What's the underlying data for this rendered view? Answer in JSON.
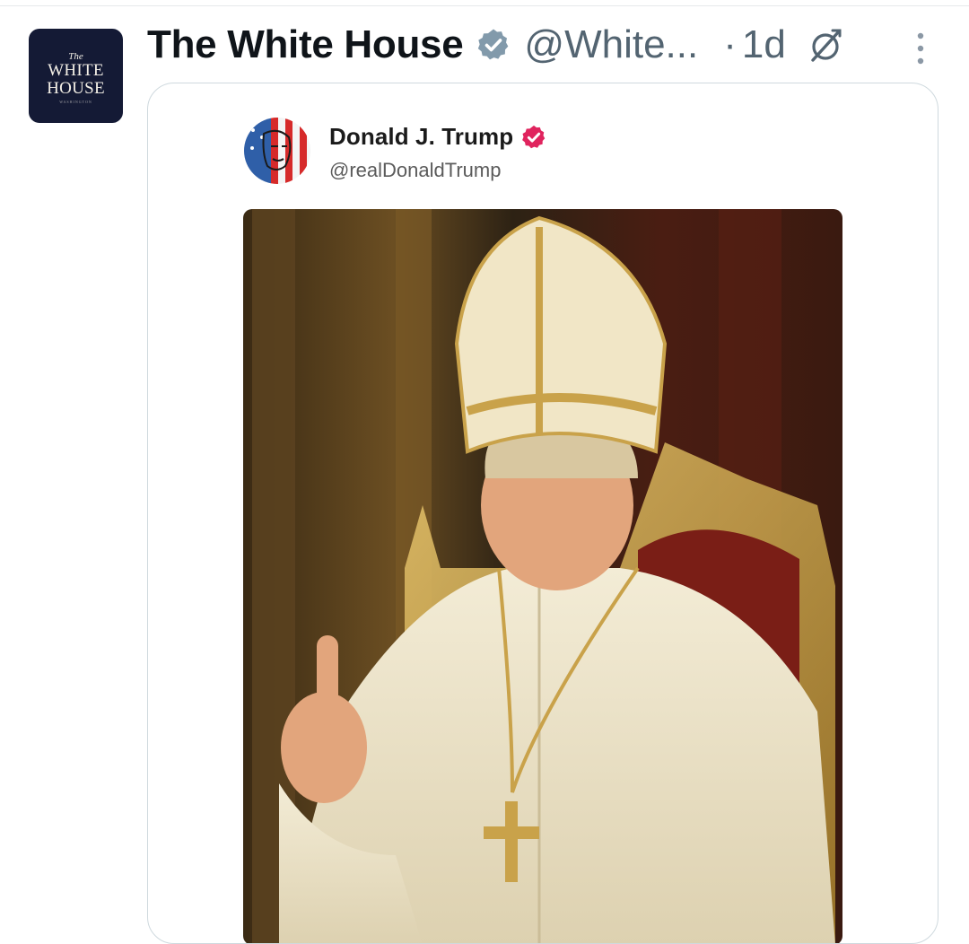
{
  "tweet": {
    "avatar": {
      "line1": "The",
      "line2": "WHITE",
      "line3": "HOUSE",
      "line4": "WASHINGTON"
    },
    "display_name": "The White House",
    "handle": "@White...",
    "separator": "·",
    "time": "1d",
    "icons": {
      "verified": "verified-badge-icon",
      "edit": "no-edit-icon",
      "more": "more-vertical-icon"
    },
    "colors": {
      "verified_badge": "#829aab",
      "text_secondary": "#536471",
      "card_border": "#cfd9de"
    }
  },
  "quoted_post": {
    "author_name": "Donald J. Trump",
    "author_handle": "@realDonaldTrump",
    "badge_color": "#e0245e",
    "image": "ai-portrait-pope-figure"
  }
}
